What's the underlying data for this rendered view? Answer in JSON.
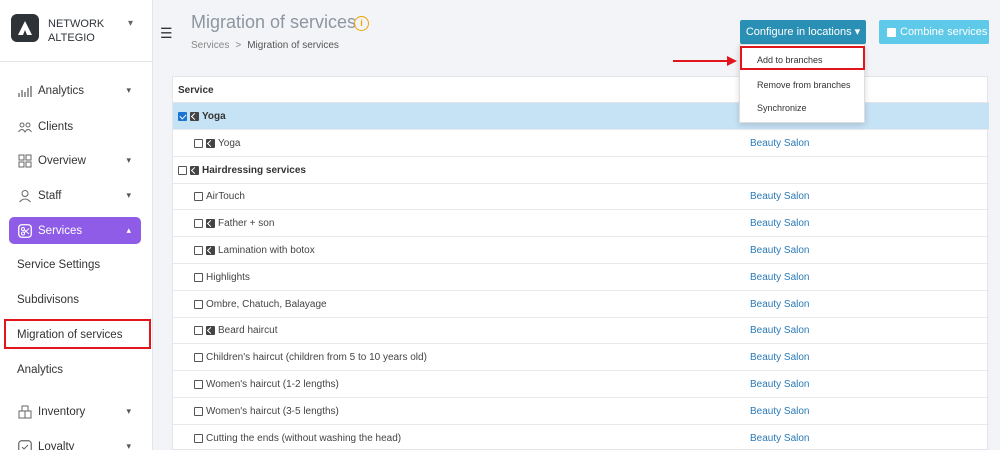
{
  "brand": {
    "line1": "NETWORK",
    "line2": "ALTEGIO"
  },
  "sidebar": {
    "items": [
      {
        "label": "Analytics",
        "icon": "analytics-icon"
      },
      {
        "label": "Clients",
        "icon": "clients-icon"
      },
      {
        "label": "Overview",
        "icon": "overview-icon"
      },
      {
        "label": "Staff",
        "icon": "staff-icon"
      },
      {
        "label": "Services",
        "icon": "services-icon"
      },
      {
        "label": "Inventory",
        "icon": "inventory-icon"
      },
      {
        "label": "Loyalty",
        "icon": "loyalty-icon"
      }
    ],
    "sub_items": [
      "Service Settings",
      "Subdivisons",
      "Migration of services",
      "Analytics"
    ]
  },
  "header": {
    "title": "Migration of services",
    "breadcrumb": [
      "Services",
      ">",
      "Migration of services"
    ],
    "configure_label": "Configure in locations ▾",
    "combine_label": "Combine services"
  },
  "dropdown": {
    "items": [
      "Add to branches",
      "Remove from branches",
      "Synchronize"
    ]
  },
  "table": {
    "header_service": "Service",
    "rows": [
      {
        "name": "Yoga",
        "group": true,
        "checked": true,
        "shared": true,
        "branch": ""
      },
      {
        "name": "Yoga",
        "group": false,
        "checked": false,
        "shared": true,
        "branch": "Beauty Salon"
      },
      {
        "name": "Hairdressing services",
        "group": true,
        "checked": false,
        "shared": true,
        "branch": ""
      },
      {
        "name": "AirTouch",
        "group": false,
        "checked": false,
        "shared": false,
        "branch": "Beauty Salon"
      },
      {
        "name": "Father + son",
        "group": false,
        "checked": false,
        "shared": true,
        "branch": "Beauty Salon"
      },
      {
        "name": "Lamination with botox",
        "group": false,
        "checked": false,
        "shared": true,
        "branch": "Beauty Salon"
      },
      {
        "name": "Highlights",
        "group": false,
        "checked": false,
        "shared": false,
        "branch": "Beauty Salon"
      },
      {
        "name": "Ombre, Chatuch, Balayage",
        "group": false,
        "checked": false,
        "shared": false,
        "branch": "Beauty Salon"
      },
      {
        "name": "Beard haircut",
        "group": false,
        "checked": false,
        "shared": true,
        "branch": "Beauty Salon"
      },
      {
        "name": "Children's haircut (children from 5 to 10 years old)",
        "group": false,
        "checked": false,
        "shared": false,
        "branch": "Beauty Salon"
      },
      {
        "name": "Women's haircut (1-2 lengths)",
        "group": false,
        "checked": false,
        "shared": false,
        "branch": "Beauty Salon"
      },
      {
        "name": "Women's haircut (3-5 lengths)",
        "group": false,
        "checked": false,
        "shared": false,
        "branch": "Beauty Salon"
      },
      {
        "name": "Cutting the ends (without washing the head)",
        "group": false,
        "checked": false,
        "shared": false,
        "branch": "Beauty Salon"
      }
    ]
  },
  "colors": {
    "accent": "#8e5ce6",
    "primary_button": "#2a8fb4",
    "secondary_button": "#5ec9e8",
    "selected_row": "#c6e2f5",
    "link": "#2a7ab8",
    "annotation": "#e0161c"
  }
}
